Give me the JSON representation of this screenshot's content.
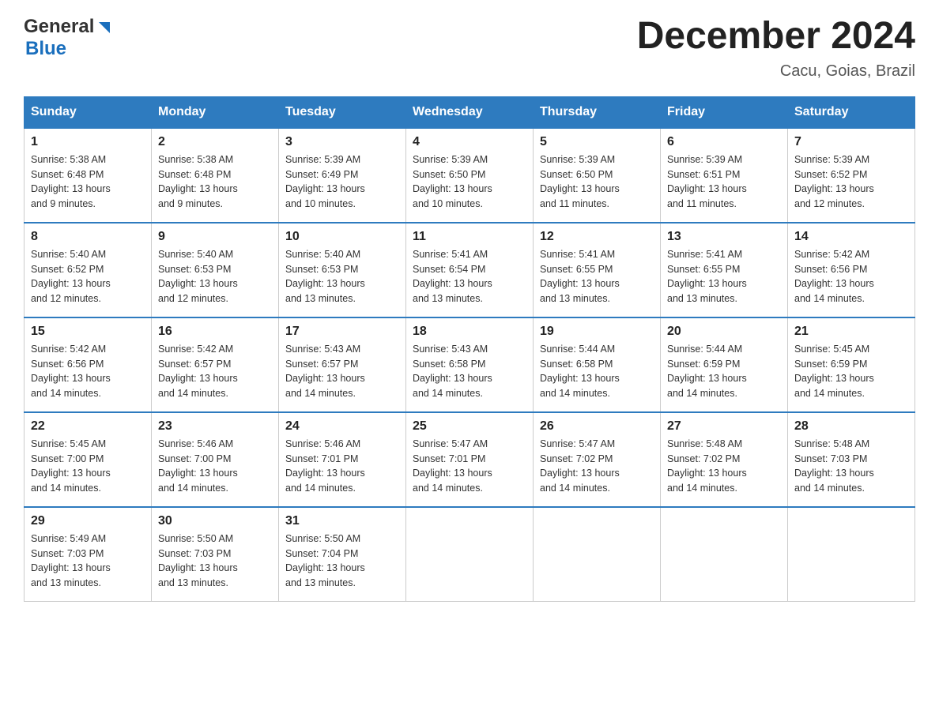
{
  "header": {
    "logo_general": "General",
    "logo_blue": "Blue",
    "title": "December 2024",
    "subtitle": "Cacu, Goias, Brazil"
  },
  "days_of_week": [
    "Sunday",
    "Monday",
    "Tuesday",
    "Wednesday",
    "Thursday",
    "Friday",
    "Saturday"
  ],
  "weeks": [
    [
      {
        "day": "1",
        "sunrise": "5:38 AM",
        "sunset": "6:48 PM",
        "daylight": "13 hours and 9 minutes."
      },
      {
        "day": "2",
        "sunrise": "5:38 AM",
        "sunset": "6:48 PM",
        "daylight": "13 hours and 9 minutes."
      },
      {
        "day": "3",
        "sunrise": "5:39 AM",
        "sunset": "6:49 PM",
        "daylight": "13 hours and 10 minutes."
      },
      {
        "day": "4",
        "sunrise": "5:39 AM",
        "sunset": "6:50 PM",
        "daylight": "13 hours and 10 minutes."
      },
      {
        "day": "5",
        "sunrise": "5:39 AM",
        "sunset": "6:50 PM",
        "daylight": "13 hours and 11 minutes."
      },
      {
        "day": "6",
        "sunrise": "5:39 AM",
        "sunset": "6:51 PM",
        "daylight": "13 hours and 11 minutes."
      },
      {
        "day": "7",
        "sunrise": "5:39 AM",
        "sunset": "6:52 PM",
        "daylight": "13 hours and 12 minutes."
      }
    ],
    [
      {
        "day": "8",
        "sunrise": "5:40 AM",
        "sunset": "6:52 PM",
        "daylight": "13 hours and 12 minutes."
      },
      {
        "day": "9",
        "sunrise": "5:40 AM",
        "sunset": "6:53 PM",
        "daylight": "13 hours and 12 minutes."
      },
      {
        "day": "10",
        "sunrise": "5:40 AM",
        "sunset": "6:53 PM",
        "daylight": "13 hours and 13 minutes."
      },
      {
        "day": "11",
        "sunrise": "5:41 AM",
        "sunset": "6:54 PM",
        "daylight": "13 hours and 13 minutes."
      },
      {
        "day": "12",
        "sunrise": "5:41 AM",
        "sunset": "6:55 PM",
        "daylight": "13 hours and 13 minutes."
      },
      {
        "day": "13",
        "sunrise": "5:41 AM",
        "sunset": "6:55 PM",
        "daylight": "13 hours and 13 minutes."
      },
      {
        "day": "14",
        "sunrise": "5:42 AM",
        "sunset": "6:56 PM",
        "daylight": "13 hours and 14 minutes."
      }
    ],
    [
      {
        "day": "15",
        "sunrise": "5:42 AM",
        "sunset": "6:56 PM",
        "daylight": "13 hours and 14 minutes."
      },
      {
        "day": "16",
        "sunrise": "5:42 AM",
        "sunset": "6:57 PM",
        "daylight": "13 hours and 14 minutes."
      },
      {
        "day": "17",
        "sunrise": "5:43 AM",
        "sunset": "6:57 PM",
        "daylight": "13 hours and 14 minutes."
      },
      {
        "day": "18",
        "sunrise": "5:43 AM",
        "sunset": "6:58 PM",
        "daylight": "13 hours and 14 minutes."
      },
      {
        "day": "19",
        "sunrise": "5:44 AM",
        "sunset": "6:58 PM",
        "daylight": "13 hours and 14 minutes."
      },
      {
        "day": "20",
        "sunrise": "5:44 AM",
        "sunset": "6:59 PM",
        "daylight": "13 hours and 14 minutes."
      },
      {
        "day": "21",
        "sunrise": "5:45 AM",
        "sunset": "6:59 PM",
        "daylight": "13 hours and 14 minutes."
      }
    ],
    [
      {
        "day": "22",
        "sunrise": "5:45 AM",
        "sunset": "7:00 PM",
        "daylight": "13 hours and 14 minutes."
      },
      {
        "day": "23",
        "sunrise": "5:46 AM",
        "sunset": "7:00 PM",
        "daylight": "13 hours and 14 minutes."
      },
      {
        "day": "24",
        "sunrise": "5:46 AM",
        "sunset": "7:01 PM",
        "daylight": "13 hours and 14 minutes."
      },
      {
        "day": "25",
        "sunrise": "5:47 AM",
        "sunset": "7:01 PM",
        "daylight": "13 hours and 14 minutes."
      },
      {
        "day": "26",
        "sunrise": "5:47 AM",
        "sunset": "7:02 PM",
        "daylight": "13 hours and 14 minutes."
      },
      {
        "day": "27",
        "sunrise": "5:48 AM",
        "sunset": "7:02 PM",
        "daylight": "13 hours and 14 minutes."
      },
      {
        "day": "28",
        "sunrise": "5:48 AM",
        "sunset": "7:03 PM",
        "daylight": "13 hours and 14 minutes."
      }
    ],
    [
      {
        "day": "29",
        "sunrise": "5:49 AM",
        "sunset": "7:03 PM",
        "daylight": "13 hours and 13 minutes."
      },
      {
        "day": "30",
        "sunrise": "5:50 AM",
        "sunset": "7:03 PM",
        "daylight": "13 hours and 13 minutes."
      },
      {
        "day": "31",
        "sunrise": "5:50 AM",
        "sunset": "7:04 PM",
        "daylight": "13 hours and 13 minutes."
      },
      null,
      null,
      null,
      null
    ]
  ],
  "labels": {
    "sunrise": "Sunrise:",
    "sunset": "Sunset:",
    "daylight": "Daylight:"
  }
}
